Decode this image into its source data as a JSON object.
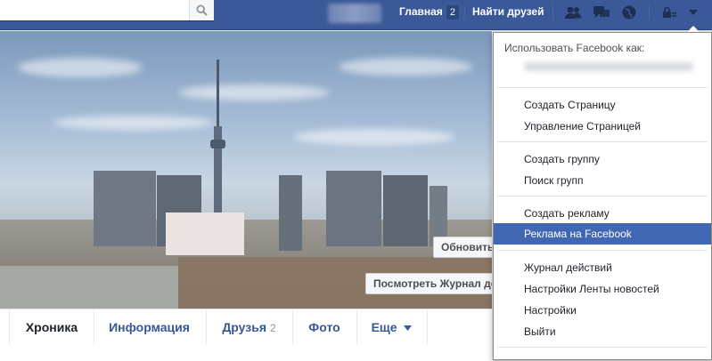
{
  "search": {
    "placeholder": ""
  },
  "nav": {
    "home_label": "Главная",
    "home_count": "2",
    "find_friends_label": "Найти друзей"
  },
  "icons": {
    "search": "magnifier-icon",
    "friend_requests": "friend-requests-icon",
    "messages": "messages-icon",
    "notifications": "globe-icon",
    "privacy": "privacy-shortcuts-icon",
    "menu": "chevron-down-icon"
  },
  "cover": {
    "update_button": "Обновить",
    "activity_log_button": "Посмотреть Журнал де"
  },
  "tabs": [
    {
      "label": "Хроника"
    },
    {
      "label": "Информация"
    },
    {
      "label": "Друзья",
      "count": "2"
    },
    {
      "label": "Фото"
    },
    {
      "label": "Еще"
    }
  ],
  "dropdown": {
    "header": "Использовать Facebook как:",
    "items": [
      "Создать Страницу",
      "Управление Страницей",
      "Создать группу",
      "Поиск групп",
      "Создать рекламу",
      "Реклама на Facebook",
      "Журнал действий",
      "Настройки Ленты новостей",
      "Настройки",
      "Выйти"
    ],
    "highlighted": "Реклама на Facebook"
  },
  "colors": {
    "brand": "#3b5998",
    "highlight": "#4267b2",
    "link": "#365899"
  }
}
